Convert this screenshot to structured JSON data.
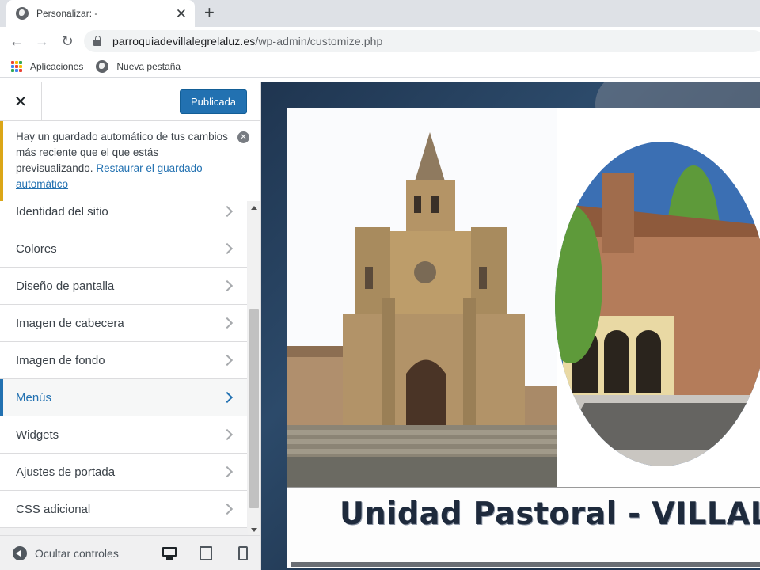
{
  "browser": {
    "tab_title": "Personalizar: -",
    "tab_close": "✕",
    "new_tab": "+",
    "back": "←",
    "forward": "→",
    "reload": "↻",
    "url_host": "parroquiadevillalegrelaluz.es",
    "url_path": "/wp-admin/customize.php",
    "bookmarks": [
      {
        "label": "Aplicaciones",
        "icon": "apps-grid-icon"
      },
      {
        "label": "Nueva pestaña",
        "icon": "globe-icon"
      }
    ],
    "apps_icon_colors": [
      "#ea4335",
      "#fbbc04",
      "#34a853",
      "#4285f4",
      "#ea4335",
      "#fbbc04",
      "#34a853",
      "#4285f4",
      "#ea4335"
    ]
  },
  "customizer": {
    "close_label": "✕",
    "publish_label": "Publicada",
    "notice": {
      "text": "Hay un guardado automático de tus cambios más reciente que el que estás previsualizando.",
      "link": "Restaurar el guardado automático",
      "dismiss": "✕"
    },
    "sections": [
      {
        "label": "Identidad del sitio",
        "active": false
      },
      {
        "label": "Colores",
        "active": false
      },
      {
        "label": "Diseño de pantalla",
        "active": false
      },
      {
        "label": "Imagen de cabecera",
        "active": false
      },
      {
        "label": "Imagen de fondo",
        "active": false
      },
      {
        "label": "Menús",
        "active": true
      },
      {
        "label": "Widgets",
        "active": false
      },
      {
        "label": "Ajustes de portada",
        "active": false
      },
      {
        "label": "CSS adicional",
        "active": false
      }
    ],
    "footer": {
      "collapse_label": "Ocultar controles"
    },
    "colors": {
      "accent": "#2271b1",
      "notice_border": "#dba617"
    }
  },
  "preview": {
    "site_title": "Unidad Pastoral - VILLALEGRE"
  }
}
